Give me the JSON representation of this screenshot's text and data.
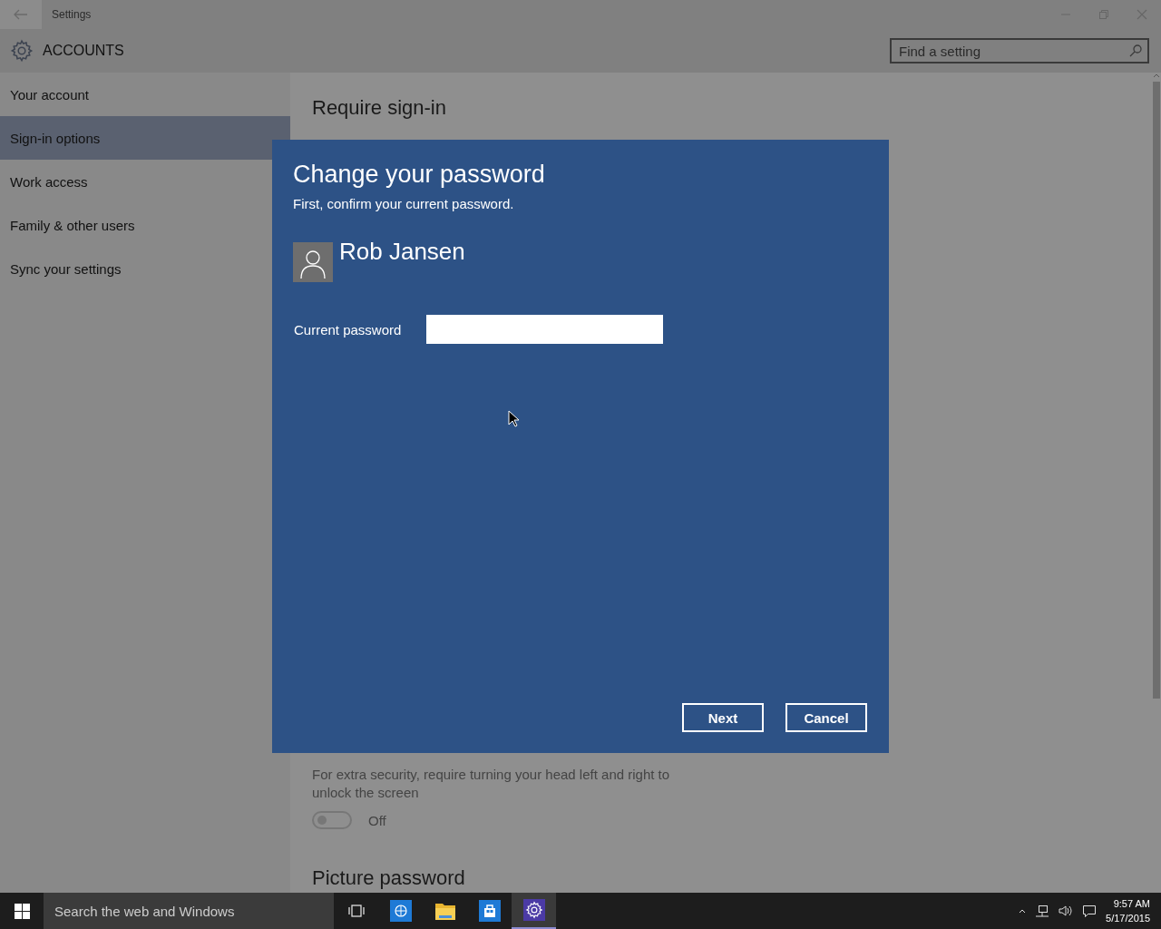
{
  "window": {
    "title": "Settings"
  },
  "header": {
    "title": "ACCOUNTS",
    "search": {
      "placeholder": "Find a setting"
    }
  },
  "sidebar": {
    "items": [
      {
        "label": "Your account",
        "selected": false
      },
      {
        "label": "Sign-in options",
        "selected": true
      },
      {
        "label": "Work access",
        "selected": false
      },
      {
        "label": "Family & other users",
        "selected": false
      },
      {
        "label": "Sync your settings",
        "selected": false
      }
    ]
  },
  "content": {
    "heading": "Require sign-in",
    "settings": [
      {
        "kind": "text",
        "text": "For extra security, require turning your head left and right to unlock the screen"
      },
      {
        "kind": "toggle",
        "on": false,
        "label": "Off"
      },
      {
        "kind": "heading",
        "text": "Picture password"
      }
    ]
  },
  "dialog": {
    "title": "Change your password",
    "subtitle": "First, confirm your current password.",
    "user_name": "Rob Jansen",
    "field": {
      "label": "Current password"
    },
    "buttons": [
      "Next",
      "Cancel"
    ]
  },
  "taskbar": {
    "search": {
      "placeholder": "Search the web and Windows"
    },
    "apps": [
      {
        "kind": "task-view",
        "active": false
      },
      {
        "kind": "browser",
        "active": false
      },
      {
        "kind": "folder",
        "active": false
      },
      {
        "kind": "store",
        "active": false
      },
      {
        "kind": "settings",
        "active": true
      }
    ],
    "clock": {
      "time": "9:57 AM",
      "date": "5/17/2015"
    }
  }
}
